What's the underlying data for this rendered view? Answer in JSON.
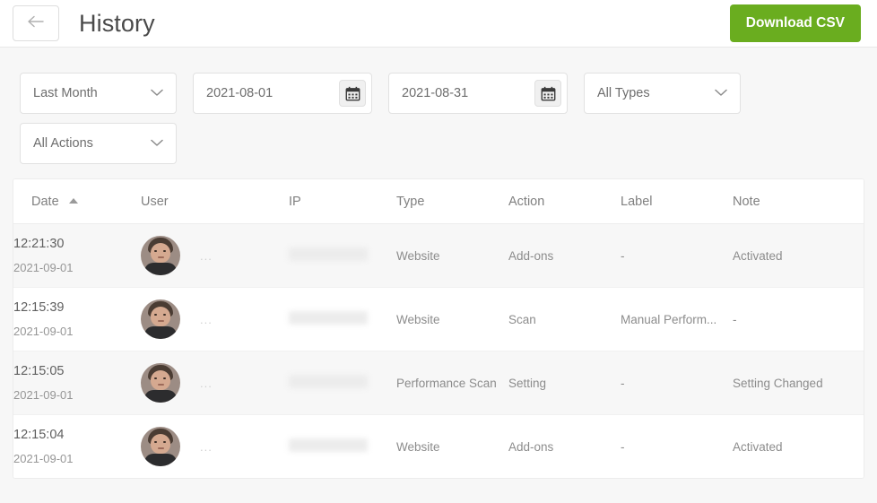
{
  "header": {
    "back_icon": "arrow-left-icon",
    "title": "History",
    "download_label": "Download CSV",
    "accent_color": "#6aad1f"
  },
  "filters": {
    "period": {
      "label": "Last Month",
      "icon": "chevron-down-icon"
    },
    "date_from": {
      "value": "2021-08-01",
      "icon": "calendar-icon"
    },
    "date_to": {
      "value": "2021-08-31",
      "icon": "calendar-icon"
    },
    "type": {
      "label": "All Types",
      "icon": "chevron-down-icon"
    },
    "action": {
      "label": "All Actions",
      "icon": "chevron-down-icon"
    }
  },
  "table": {
    "columns": {
      "date": "Date",
      "user": "User",
      "ip": "IP",
      "type": "Type",
      "action": "Action",
      "label": "Label",
      "note": "Note"
    },
    "sort": {
      "column": "Date",
      "direction": "asc",
      "icon": "caret-up-icon"
    },
    "rows": [
      {
        "time": "12:21:30",
        "day": "2021-09-01",
        "user": "...",
        "ip": "",
        "type": "Website",
        "action": "Add-ons",
        "label": "-",
        "note": "Activated"
      },
      {
        "time": "12:15:39",
        "day": "2021-09-01",
        "user": "...",
        "ip": "",
        "type": "Website",
        "action": "Scan",
        "label": "Manual Perform...",
        "note": "-"
      },
      {
        "time": "12:15:05",
        "day": "2021-09-01",
        "user": "...",
        "ip": "",
        "type": "Performance Scan",
        "action": "Setting",
        "label": "-",
        "note": "Setting Changed"
      },
      {
        "time": "12:15:04",
        "day": "2021-09-01",
        "user": "...",
        "ip": "",
        "type": "Website",
        "action": "Add-ons",
        "label": "-",
        "note": "Activated"
      }
    ]
  }
}
